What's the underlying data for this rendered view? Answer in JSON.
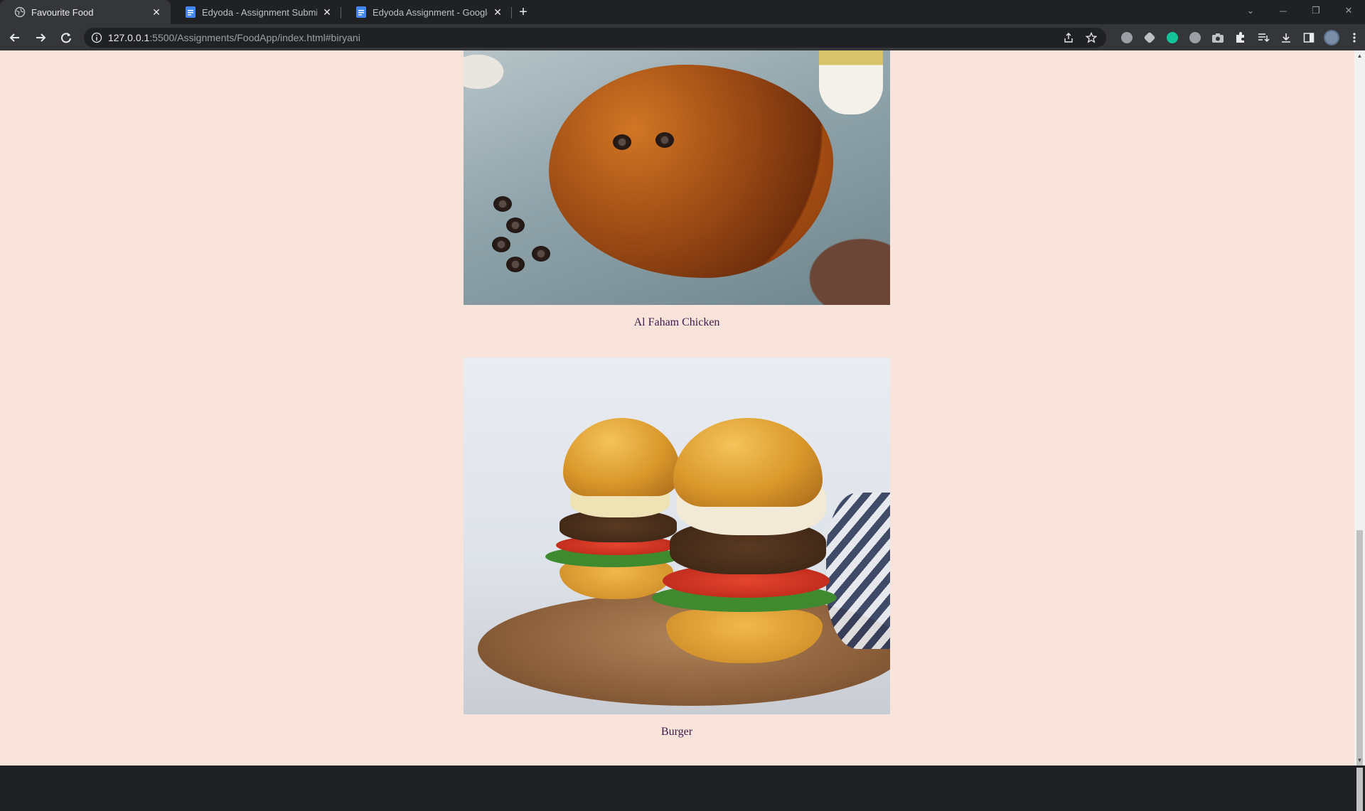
{
  "browser": {
    "tabs": [
      {
        "title": "Favourite Food",
        "icon": "globe-icon",
        "active": true
      },
      {
        "title": "Edyoda - Assignment Submission",
        "icon": "docs-icon",
        "active": false
      },
      {
        "title": "Edyoda Assignment - Google Docs",
        "icon": "docs-icon",
        "active": false
      }
    ],
    "new_tab_label": "+",
    "address": {
      "host": "127.0.0.1",
      "rest": ":5500/Assignments/FoodApp/index.html#biryani"
    }
  },
  "page": {
    "background": "#f8e4da",
    "foods": [
      {
        "name": "Al Faham Chicken"
      },
      {
        "name": "Burger"
      }
    ]
  },
  "colors": {
    "chrome_dark": "#202124",
    "chrome_toolbar": "#35363a",
    "caption_text": "#3a1a4a"
  }
}
